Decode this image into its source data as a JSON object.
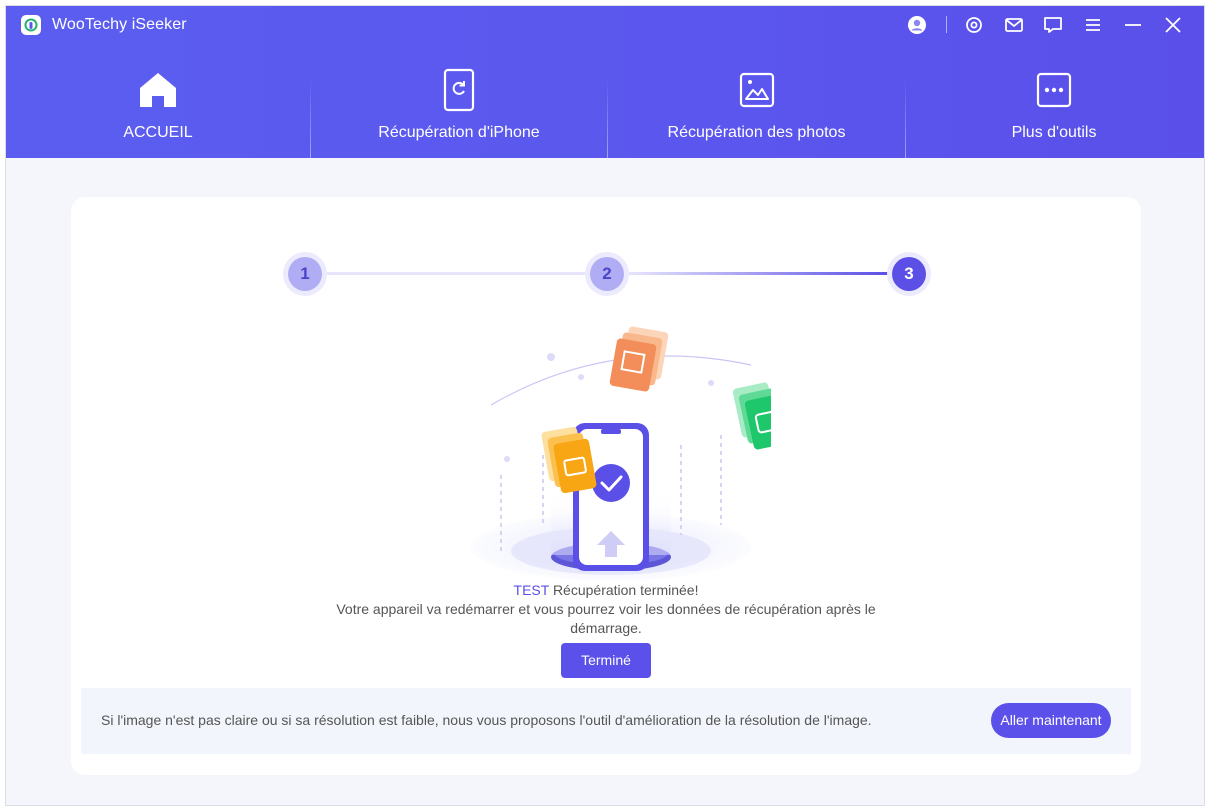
{
  "app": {
    "title": "WooTechy iSeeker"
  },
  "titlebar": {
    "icons": [
      "account-icon",
      "settings-icon",
      "mail-icon",
      "feedback-icon",
      "menu-icon",
      "minimize-icon",
      "close-icon"
    ]
  },
  "tabs": [
    {
      "label": "ACCUEIL",
      "icon": "home-icon"
    },
    {
      "label": "Récupération d'iPhone",
      "icon": "iphone-recovery-icon"
    },
    {
      "label": "Récupération des photos",
      "icon": "photo-recovery-icon"
    },
    {
      "label": "Plus d'outils",
      "icon": "more-tools-icon"
    }
  ],
  "stepper": {
    "steps": [
      "1",
      "2",
      "3"
    ],
    "current": 3
  },
  "result": {
    "device_name": "TEST",
    "status": "Récupération terminée!",
    "description_line1": "Votre appareil va redémarrer et vous pourrez voir les données de récupération après le",
    "description_line2": "démarrage.",
    "done_button": "Terminé"
  },
  "tip": {
    "text": "Si l'image n'est pas claire ou si sa résolution est faible, nous vous proposons l'outil d'amélioration de la résolution de l'image.",
    "button": "Aller maintenant"
  },
  "colors": {
    "header": "#5b57ee",
    "accent": "#5b50ea",
    "step_inactive": "#b1adf4",
    "background": "#f5f6fb"
  }
}
